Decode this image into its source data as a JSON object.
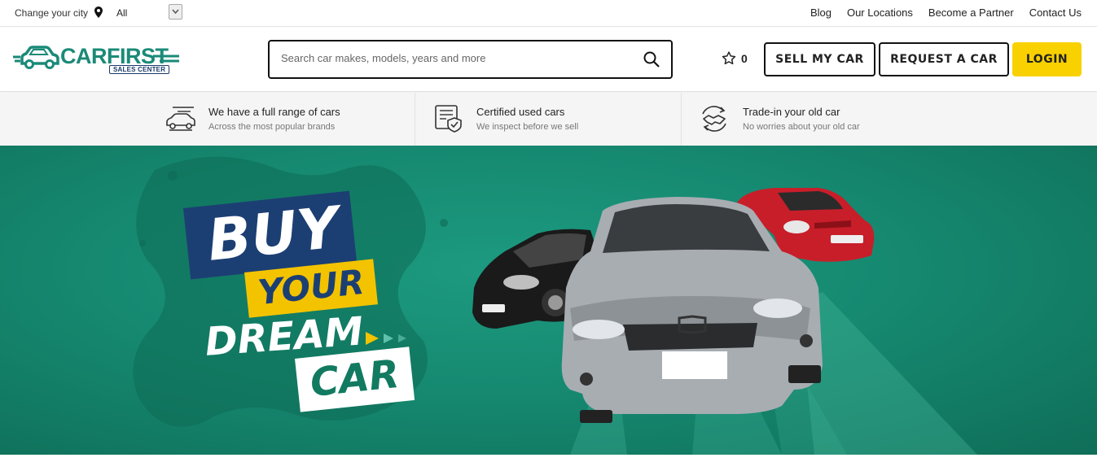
{
  "topbar": {
    "change_city_label": "Change your city",
    "city_value": "All",
    "links": [
      "Blog",
      "Our Locations",
      "Become a Partner",
      "Contact Us"
    ]
  },
  "header": {
    "logo_text": "CARFIRST",
    "logo_subtext": "SALES CENTER",
    "search_placeholder": "Search car makes, models, years and more",
    "favorites_count": "0",
    "sell_label": "SELL MY CAR",
    "request_label": "REQUEST A CAR",
    "login_label": "LOGIN"
  },
  "features": [
    {
      "title": "We have a full range of cars",
      "subtitle": "Across the most popular brands",
      "icon": "car-icon"
    },
    {
      "title": "Certified used cars",
      "subtitle": "We inspect before we sell",
      "icon": "certificate-icon"
    },
    {
      "title": "Trade-in your old car",
      "subtitle": "No worries about your old car",
      "icon": "handshake-icon"
    }
  ],
  "hero": {
    "line1": "BUY",
    "line2": "YOUR",
    "line3": "DREAM",
    "line4": "CAR"
  },
  "colors": {
    "brand_green": "#1a8a78",
    "hero_green": "#168a71",
    "accent_yellow": "#f9d100",
    "navy": "#1c3f73"
  }
}
